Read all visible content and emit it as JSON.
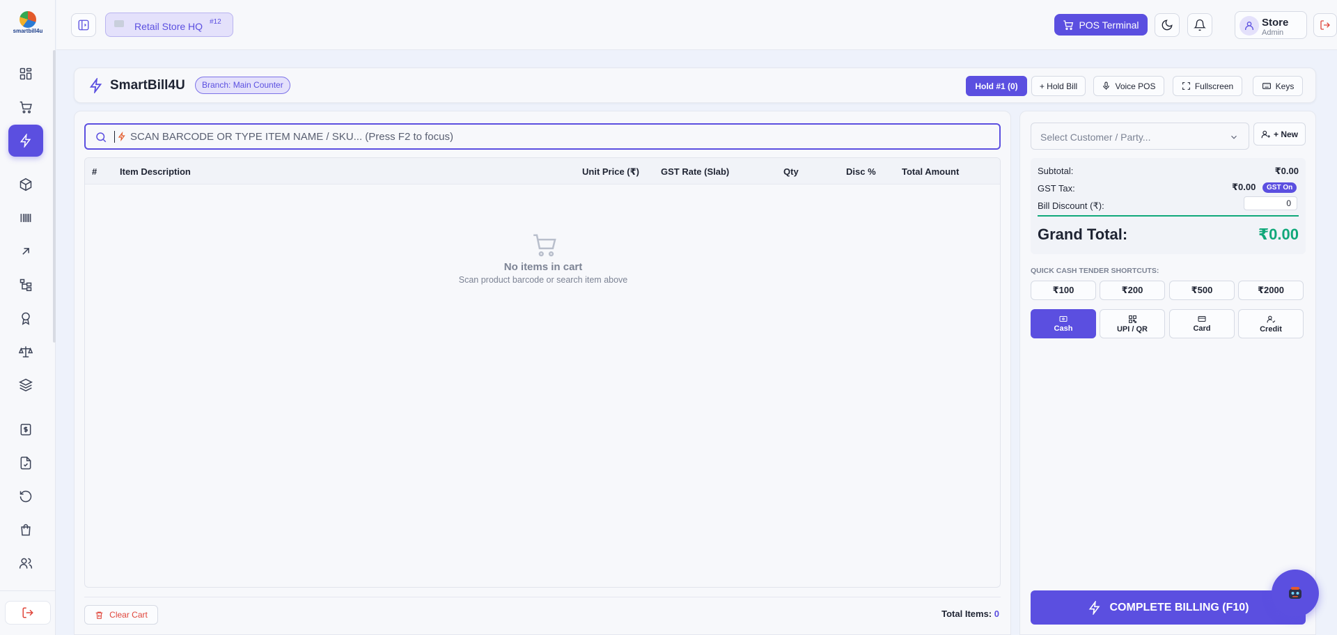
{
  "sidebar": {
    "logo_text": "smartbill4u",
    "items": [
      {
        "icon": "dashboard-grid-icon"
      },
      {
        "icon": "cart-icon"
      },
      {
        "icon": "bolt-icon",
        "active": true
      },
      {
        "icon": "box-icon"
      },
      {
        "icon": "barcode-icon"
      },
      {
        "icon": "arrow-up-right-icon"
      },
      {
        "icon": "hierarchy-icon"
      },
      {
        "icon": "award-icon"
      },
      {
        "icon": "scale-icon"
      },
      {
        "icon": "layers-icon"
      },
      {
        "icon": "dollar-file-icon"
      },
      {
        "icon": "file-check-icon"
      },
      {
        "icon": "refresh-icon"
      },
      {
        "icon": "shopping-bag-icon"
      },
      {
        "icon": "users-icon"
      }
    ]
  },
  "topbar": {
    "store_name": "Retail Store HQ",
    "store_number": "#12",
    "pos_terminal_label": "POS Terminal",
    "user_name": "Store",
    "user_role": "Admin"
  },
  "header": {
    "title": "SmartBill4U",
    "branch": "Branch: Main Counter",
    "hold_label": "Hold #1 (0)",
    "hold_bill_label": "+ Hold Bill",
    "voice_pos_label": "Voice POS",
    "fullscreen_label": "Fullscreen",
    "keys_label": "Keys"
  },
  "search": {
    "placeholder": "SCAN BARCODE OR TYPE ITEM NAME / SKU... (Press F2 to focus)"
  },
  "table": {
    "columns": [
      "#",
      "Item Description",
      "Unit Price (₹)",
      "GST Rate (Slab)",
      "Qty",
      "Disc %",
      "Total Amount"
    ],
    "empty_title": "No items in cart",
    "empty_subtitle": "Scan product barcode or search item above"
  },
  "footer": {
    "clear_cart_label": "Clear Cart",
    "total_items_label": "Total Items:",
    "total_items_value": "0"
  },
  "billing": {
    "customer_placeholder": "Select Customer / Party...",
    "new_label": "+ New",
    "subtotal_label": "Subtotal:",
    "subtotal_value": "₹0.00",
    "gst_label": "GST Tax:",
    "gst_value": "₹0.00",
    "gst_badge": "GST On",
    "discount_label": "Bill Discount (₹):",
    "discount_value": "0",
    "grand_total_label": "Grand Total:",
    "grand_total_value": "₹0.00",
    "quick_title": "QUICK CASH TENDER SHORTCUTS:",
    "tenders": [
      "₹100",
      "₹200",
      "₹500",
      "₹2000"
    ],
    "payment_modes": [
      "Cash",
      "UPI / QR",
      "Card",
      "Credit"
    ],
    "complete_label": "COMPLETE BILLING (F10)"
  },
  "colors": {
    "accent": "#5b4fe0",
    "success": "#10a87a",
    "danger": "#e0453a"
  }
}
